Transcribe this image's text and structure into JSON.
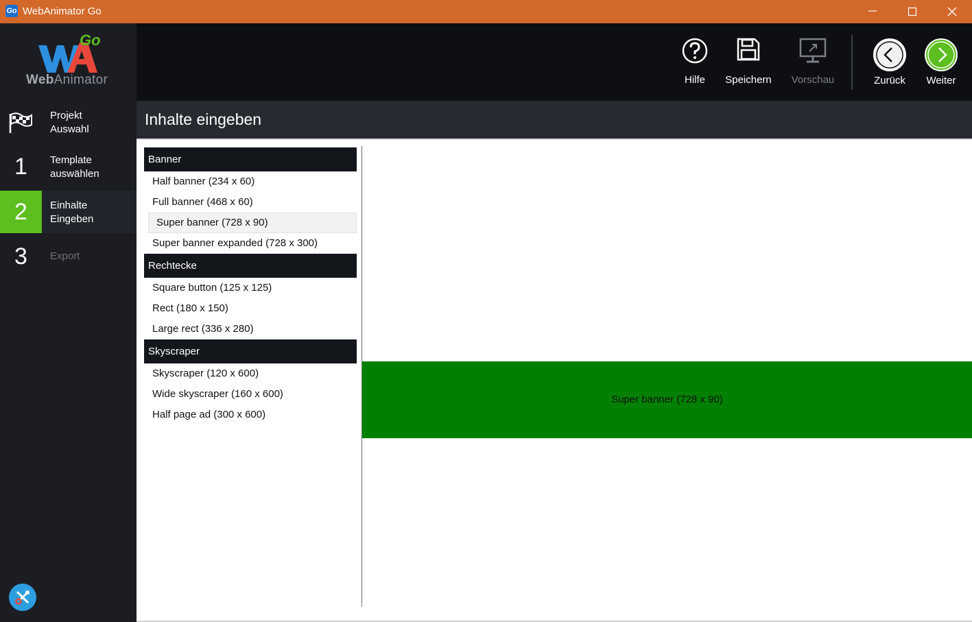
{
  "window": {
    "title": "WebAnimator Go",
    "icon_text": "Go",
    "buttons": [
      "minimize-icon",
      "maximize-icon",
      "close-icon"
    ]
  },
  "logo": {
    "brand_bold": "Web",
    "brand_rest": "Animator",
    "badge": "Go"
  },
  "sidebar": {
    "items": [
      {
        "icon": "flag-icon",
        "label": "Projekt\nAuswahl",
        "state": "normal"
      },
      {
        "number": "1",
        "label": "Template\nauswählen",
        "state": "normal"
      },
      {
        "number": "2",
        "label": "Einhalte\nEingeben",
        "state": "active"
      },
      {
        "number": "3",
        "label": "Export",
        "state": "disabled"
      }
    ],
    "tools_icon": "wrench-screwdriver-icon"
  },
  "toolbar": {
    "help_label": "Hilfe",
    "save_label": "Speichern",
    "preview_label": "Vorschau",
    "back_label": "Zurück",
    "next_label": "Weiter"
  },
  "section": {
    "title": "Inhalte eingeben"
  },
  "formats": {
    "groups": [
      {
        "name": "Banner",
        "items": [
          "Half banner (234 x 60)",
          "Full banner (468 x 60)",
          "Super banner (728 x 90)",
          "Super banner expanded (728 x 300)"
        ]
      },
      {
        "name": "Rechtecke",
        "items": [
          "Square button (125 x 125)",
          "Rect (180 x 150)",
          "Large rect (336 x 280)"
        ]
      },
      {
        "name": "Skyscraper",
        "items": [
          "Skyscraper (120 x 600)",
          "Wide skyscraper (160 x 600)",
          "Half page ad (300 x 600)"
        ]
      }
    ],
    "selected": "Super banner (728 x 90)"
  },
  "preview": {
    "label": "Super banner (728 x 90)",
    "color": "#008000"
  },
  "colors": {
    "titlebar": "#d2692b",
    "accent_green": "#5cbe1f",
    "sidebar_bg": "#1b1d23",
    "toolbar_bg": "#0d0f13"
  }
}
